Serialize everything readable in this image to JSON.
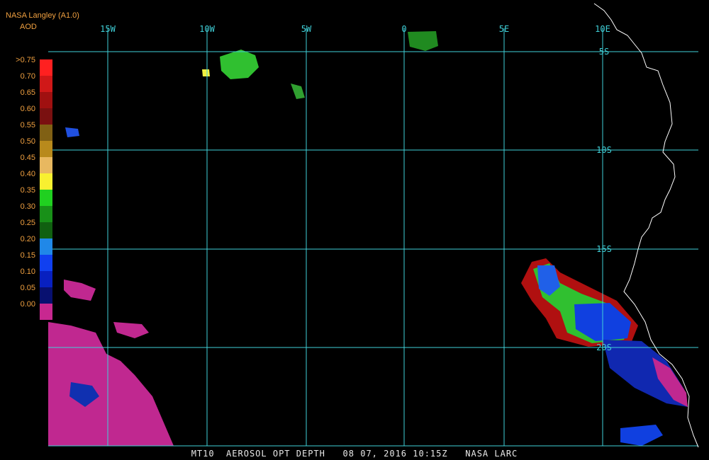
{
  "header": {
    "title": "NASA Langley (A1.0)",
    "product": "AOD"
  },
  "legend": {
    "labels": [
      ">0.75",
      "0.70",
      "0.65",
      "0.60",
      "0.55",
      "0.50",
      "0.45",
      "0.40",
      "0.35",
      "0.30",
      "0.25",
      "0.20",
      "0.15",
      "0.10",
      "0.05",
      "0.00"
    ],
    "colors": [
      "#ff2020",
      "#d01818",
      "#a01010",
      "#7a1010",
      "#806014",
      "#b88a1c",
      "#e8b860",
      "#f8f030",
      "#20d020",
      "#189018",
      "#106010",
      "#2088e8",
      "#1040f0",
      "#0820c0",
      "#081070",
      "#c82890"
    ]
  },
  "map": {
    "longitude_labels": [
      "15W",
      "10W",
      "5W",
      "0",
      "5E",
      "10E"
    ],
    "latitude_labels": [
      "5S",
      "10S",
      "15S",
      "20S"
    ],
    "grid_color": "#40d0d8",
    "coast_color": "#ffffff"
  },
  "footer": {
    "text": "MT10  AEROSOL OPT DEPTH   08 07, 2016 10:15Z   NASA LARC"
  }
}
